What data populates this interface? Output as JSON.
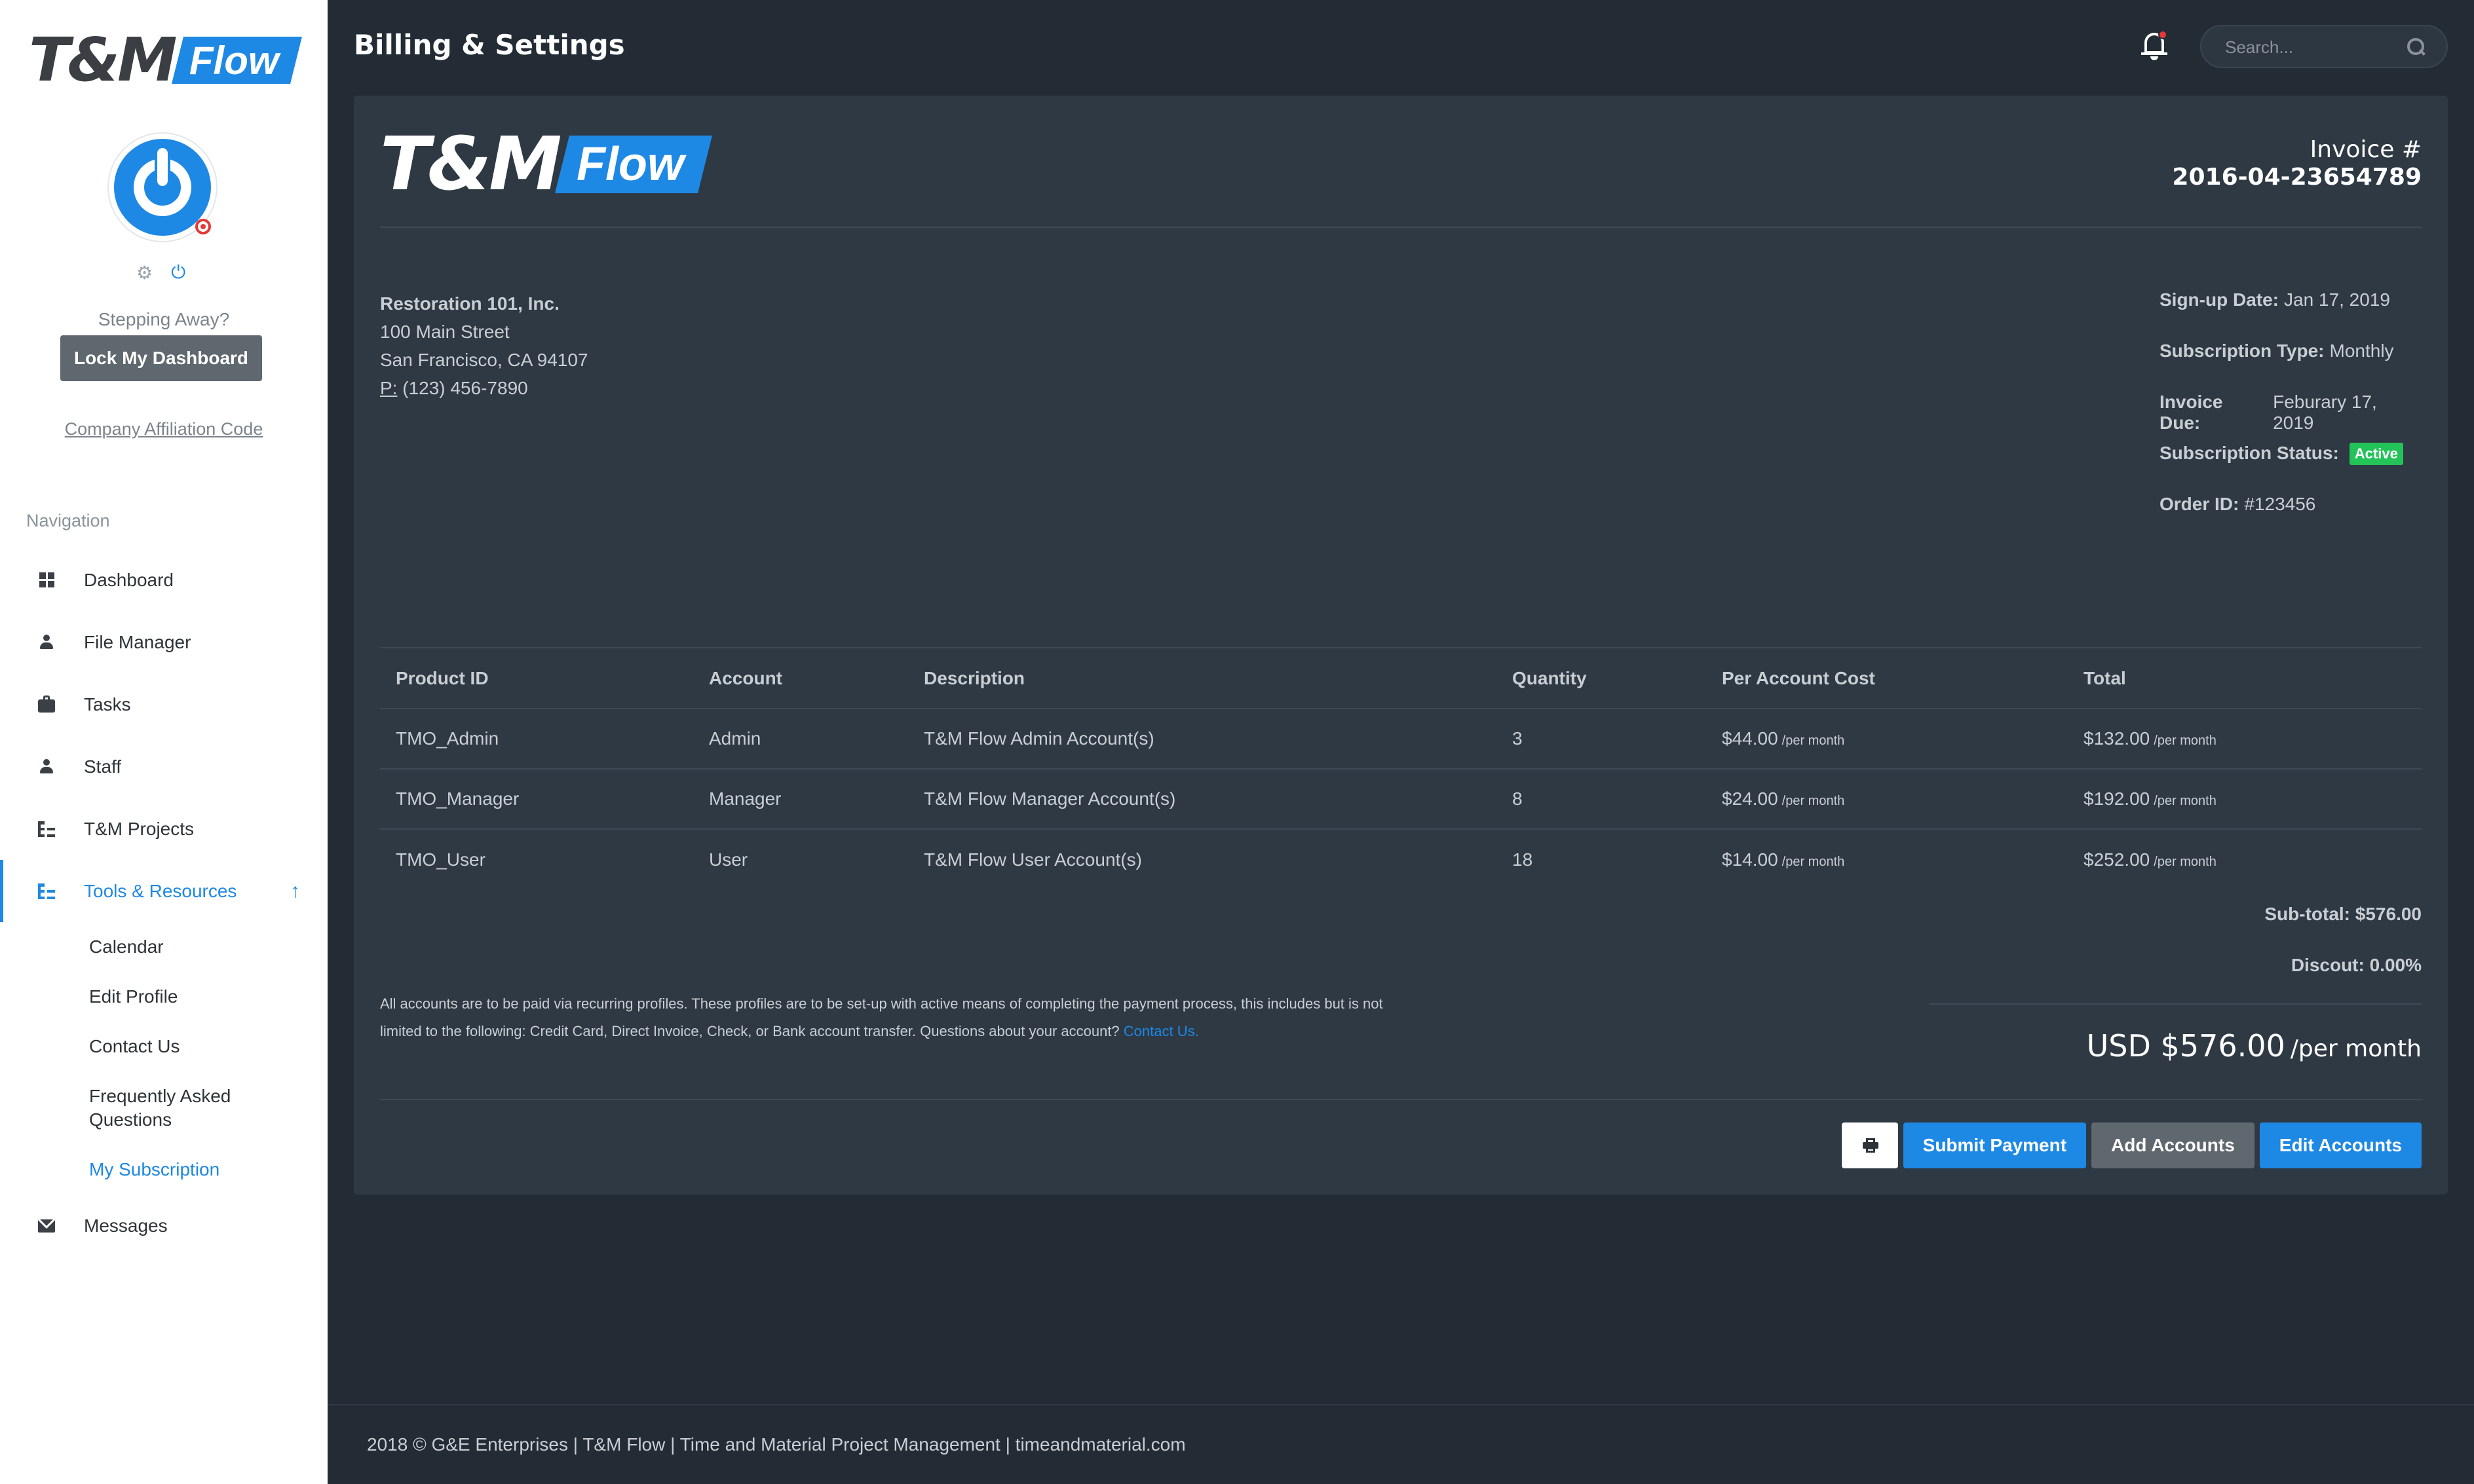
{
  "app": {
    "logo_tm": "T&M",
    "logo_flow": "Flow",
    "page_title": "Billing & Settings"
  },
  "sidebar": {
    "stepping_away": "Stepping Away?",
    "lock_button": "Lock My Dashboard",
    "affiliation_link": "Company Affiliation Code",
    "nav_title": "Navigation",
    "items": [
      {
        "label": "Dashboard",
        "icon": "dashboard-icon"
      },
      {
        "label": "File Manager",
        "icon": "user-icon"
      },
      {
        "label": "Tasks",
        "icon": "briefcase-icon"
      },
      {
        "label": "Staff",
        "icon": "user-icon"
      },
      {
        "label": "T&M Projects",
        "icon": "tree-icon"
      },
      {
        "label": "Tools & Resources",
        "icon": "tree-icon",
        "expanded": true,
        "active": true
      },
      {
        "label": "Messages",
        "icon": "mail-icon"
      }
    ],
    "sub_items": [
      {
        "label": "Calendar"
      },
      {
        "label": "Edit Profile"
      },
      {
        "label": "Contact Us"
      },
      {
        "label": "Frequently Asked Questions"
      },
      {
        "label": "My Subscription",
        "active": true
      }
    ]
  },
  "header": {
    "search_placeholder": "Search..."
  },
  "invoice": {
    "label": "Invoice #",
    "number": "2016-04-23654789",
    "company": "Restoration 101, Inc.",
    "street": "100 Main Street",
    "city": "San Francisco, CA 94107",
    "phone_label": "P:",
    "phone": "(123) 456-7890",
    "meta": {
      "signup_label": "Sign-up Date:",
      "signup_value": "Jan 17, 2019",
      "subtype_label": "Subscription Type:",
      "subtype_value": "Monthly",
      "due_label": "Invoice Due:",
      "due_value": "Feburary 17, 2019",
      "status_label": "Subscription Status:",
      "status_value": "Active",
      "order_label": "Order ID:",
      "order_value": "#123456"
    },
    "columns": [
      "Product ID",
      "Account",
      "Description",
      "Quantity",
      "Per Account Cost",
      "Total"
    ],
    "per_month": "/per month",
    "rows": [
      {
        "product_id": "TMO_Admin",
        "account": "Admin",
        "description": "T&M Flow Admin Account(s)",
        "quantity": "3",
        "cost": "$44.00",
        "total": "$132.00"
      },
      {
        "product_id": "TMO_Manager",
        "account": "Manager",
        "description": "T&M Flow Manager Account(s)",
        "quantity": "8",
        "cost": "$24.00",
        "total": "$192.00"
      },
      {
        "product_id": "TMO_User",
        "account": "User",
        "description": "T&M Flow User Account(s)",
        "quantity": "18",
        "cost": "$14.00",
        "total": "$252.00"
      }
    ],
    "subtotal": "Sub-total: $576.00",
    "discount": "Discout: 0.00%",
    "total": "USD $576.00",
    "total_per": "/per month",
    "note": "All accounts are to be paid via recurring profiles. These profiles are to be set-up with active means of completing the payment process, this includes but is not limited to the following: Credit Card, Direct Invoice, Check, or Bank account transfer. Questions about your account?",
    "note_link": "Contact Us."
  },
  "actions": {
    "submit": "Submit Payment",
    "add": "Add Accounts",
    "edit": "Edit Accounts"
  },
  "footer": {
    "text": "2018 © G&E Enterprises | T&M Flow | Time and Material Project Management | timeandmaterial.com"
  },
  "colors": {
    "accent": "#1e88e5",
    "active_badge": "#23c35a",
    "background": "#232c35",
    "card": "#2e3944"
  }
}
